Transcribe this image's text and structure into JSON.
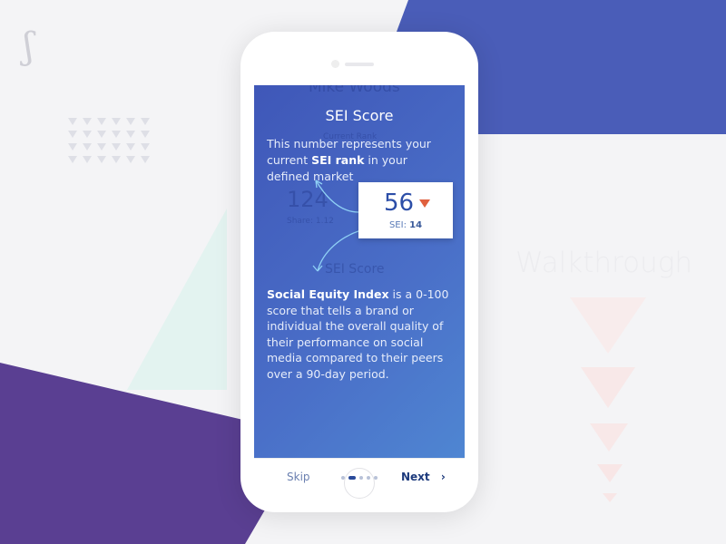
{
  "background": {
    "logo": "S",
    "watermark": "Walkthrough",
    "colors": {
      "blue": "#4a5db8",
      "purple": "#5a3f92",
      "mint": "#e3f3f0"
    }
  },
  "screen": {
    "ghost": {
      "name": "Mike Woods",
      "rank_label": "Current Rank",
      "rank": "124",
      "share": "Share: 1.12",
      "section": "SEI Score"
    },
    "title": "SEI Score",
    "intro": {
      "before": "This number represents your current ",
      "bold": "SEI rank",
      "after": " in your defined market"
    },
    "card": {
      "value": "56",
      "trend": "down",
      "sei_label": "SEI:",
      "sei_value": "14"
    },
    "description": {
      "bold": "Social Equity Index",
      "text": " is a 0-100 score that tells a brand or individual the overall quality of their performance on social media compared to their peers over a 90-day period."
    }
  },
  "footer": {
    "skip": "Skip",
    "next": "Next",
    "next_icon": "chevron-right-icon",
    "page_count": 5,
    "current_page": 2
  }
}
